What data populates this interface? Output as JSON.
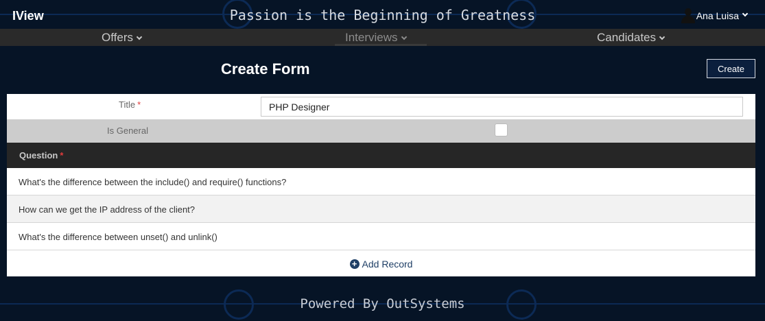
{
  "header": {
    "brand": "IView",
    "slogan": "Passion is the Beginning of Greatness",
    "user_name": "Ana Luisa"
  },
  "nav": {
    "items": [
      {
        "label": "Offers",
        "active": false
      },
      {
        "label": "Interviews",
        "active": true
      },
      {
        "label": "Candidates",
        "active": false
      }
    ]
  },
  "page": {
    "title": "Create Form",
    "create_label": "Create"
  },
  "form": {
    "title_label": "Title",
    "title_value": "PHP Designer",
    "required_mark": "*",
    "general_label": "Is General",
    "is_general": false
  },
  "questions": {
    "header": "Question",
    "rows": [
      "What's the difference between the include() and require() functions?",
      "How can we get the IP address of the client?",
      "What's the difference between unset() and unlink()"
    ],
    "add_label": "Add Record"
  },
  "footer": {
    "text": "Powered By OutSystems"
  },
  "colors": {
    "background": "#061426",
    "navbar": "#2a2a2a",
    "question_header": "#262626",
    "general_row": "#cccccc",
    "accent": "#1f3f66",
    "required": "#e03b3b"
  }
}
